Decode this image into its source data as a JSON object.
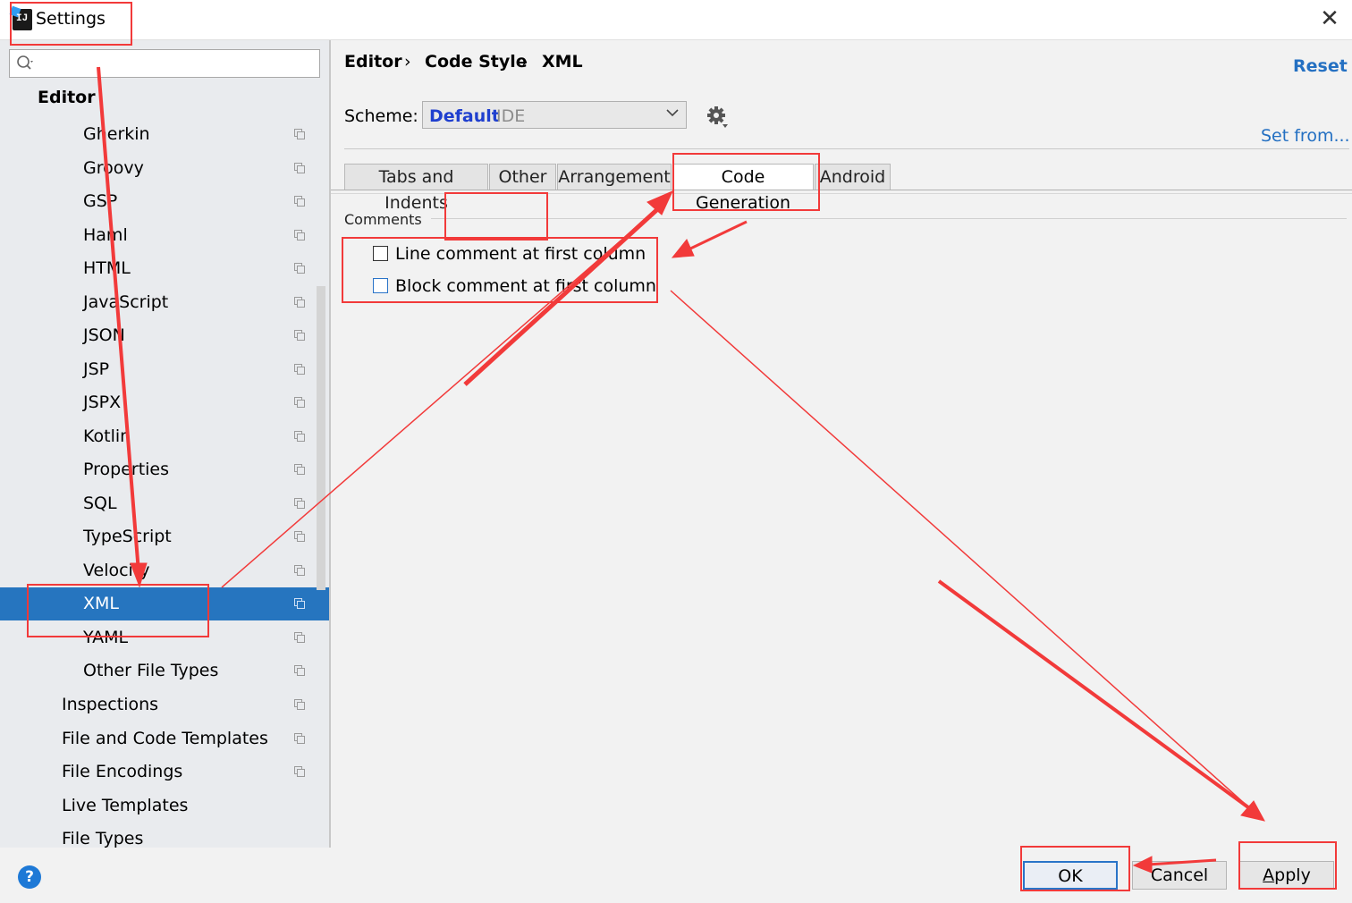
{
  "window": {
    "title": "Settings",
    "close": "✕",
    "app_icon_text": "IJ"
  },
  "sidebar": {
    "search_placeholder": "",
    "section_title": "Editor",
    "items": [
      {
        "label": "Gherkin"
      },
      {
        "label": "Groovy"
      },
      {
        "label": "GSP"
      },
      {
        "label": "Haml"
      },
      {
        "label": "HTML"
      },
      {
        "label": "JavaScript"
      },
      {
        "label": "JSON"
      },
      {
        "label": "JSP"
      },
      {
        "label": "JSPX"
      },
      {
        "label": "Kotlin"
      },
      {
        "label": "Properties"
      },
      {
        "label": "SQL"
      },
      {
        "label": "TypeScript"
      },
      {
        "label": "Velocity"
      },
      {
        "label": "XML",
        "selected": true
      },
      {
        "label": "YAML"
      },
      {
        "label": "Other File Types"
      }
    ],
    "top_items": [
      {
        "label": "Inspections"
      },
      {
        "label": "File and Code Templates"
      },
      {
        "label": "File Encodings"
      },
      {
        "label": "Live Templates"
      },
      {
        "label": "File Types"
      }
    ]
  },
  "breadcrumb": {
    "editor": "Editor",
    "sep": "›",
    "code_style": "Code Style",
    "xml": "XML"
  },
  "reset_label": "Reset",
  "scheme": {
    "label": "Scheme:",
    "name": "Default",
    "tag": "IDE"
  },
  "set_from_label": "Set from...",
  "tabs": [
    "Tabs and Indents",
    "Other",
    "Arrangement",
    "Code Generation",
    "Android"
  ],
  "active_tab": "Code Generation",
  "comments": {
    "title": "Comments",
    "options": [
      {
        "label": "Line comment at first column",
        "checked": false
      },
      {
        "label": "Block comment at first column",
        "checked": false
      }
    ]
  },
  "buttons": {
    "ok": "OK",
    "cancel": "Cancel",
    "apply_first": "A",
    "apply_rest": "pply",
    "help": "?"
  },
  "colors": {
    "selection": "#2675bf",
    "link": "#2470c2",
    "annotation": "#f23a3a",
    "scheme_name": "#1f3fcf"
  }
}
